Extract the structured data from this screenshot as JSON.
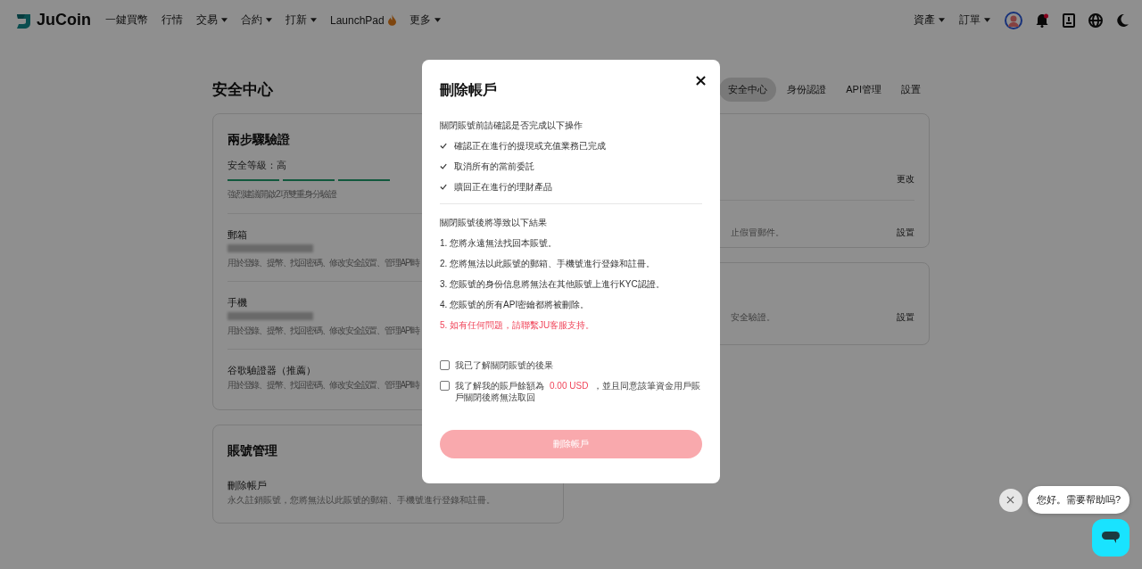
{
  "header": {
    "brand": "JuCoin",
    "nav": [
      {
        "label": "一鍵買幣",
        "dropdown": false,
        "kind": "plain"
      },
      {
        "label": "行情",
        "dropdown": false,
        "kind": "plain"
      },
      {
        "label": "交易",
        "dropdown": true,
        "kind": "plain"
      },
      {
        "label": "合約",
        "dropdown": true,
        "kind": "plain"
      },
      {
        "label": "打新",
        "dropdown": true,
        "kind": "plain"
      },
      {
        "label": "LaunchPad",
        "dropdown": false,
        "kind": "flame"
      },
      {
        "label": "更多",
        "dropdown": true,
        "kind": "plain"
      }
    ],
    "right_menus": [
      {
        "label": "資產",
        "dropdown": true
      },
      {
        "label": "訂單",
        "dropdown": true
      }
    ],
    "notification_dot": true
  },
  "page": {
    "title": "安全中心",
    "tabs": [
      {
        "label": "安全中心",
        "selected": true
      },
      {
        "label": "身份認證",
        "selected": false
      },
      {
        "label": "API管理",
        "selected": false
      },
      {
        "label": "設置",
        "selected": false
      }
    ],
    "two_step": {
      "title": "兩步驟驗證",
      "level_label": "安全等級：高",
      "segments": [
        {
          "filled": true
        },
        {
          "filled": true
        },
        {
          "filled": true
        }
      ],
      "hint": "強烈建議開啟2項雙重身分驗證",
      "rows": [
        {
          "name": "郵箱",
          "value_hidden": true,
          "description": "用於登錄、提幣、找回密碼、修改安全設置、管理API時"
        },
        {
          "name": "手機",
          "value_hidden": true,
          "description": "用於登錄、提幣、找回密碼、修改安全設置、管理API時"
        },
        {
          "name": "谷歌驗證器（推薦）",
          "value_hidden": false,
          "description": "用於登錄、提幣、找回密碼、修改安全設置、管理API時"
        }
      ]
    },
    "account": {
      "title": "賬號管理",
      "rows": [
        {
          "name": "刪除帳戶",
          "description": "永久註銷賬號，您將無法以此賬號的郵箱、手機號進行登錄和註冊。"
        }
      ]
    },
    "right_cards": [
      {
        "rows": [
          {
            "action": "更改"
          },
          {
            "description": "止假冒郵件。",
            "action": "設置"
          }
        ]
      },
      {
        "rows": [
          {
            "description": "安全驗證。",
            "action": "設置"
          }
        ]
      }
    ]
  },
  "modal": {
    "title": "刪除帳戶",
    "intro": "關閉賬號前請確認是否完成以下操作",
    "checks": [
      "確認正在進行的提現或充值業務已完成",
      "取消所有的當前委託",
      "贖回正在進行的理財產品"
    ],
    "consequence_heading": "關閉賬號後將導致以下結果",
    "consequences": [
      {
        "text": "1. 您將永遠無法找回本賬號。",
        "kind": "normal"
      },
      {
        "text": "2. 您將無法以此賬號的郵箱、手機號進行登錄和註冊。",
        "kind": "normal"
      },
      {
        "text": "3. 您賬號的身份信息將無法在其他賬號上進行KYC認證。",
        "kind": "normal"
      },
      {
        "text": "4. 您賬號的所有API密鑰都將被刪除。",
        "kind": "normal"
      },
      {
        "text": "5. 如有任何問題，請聯繫JU客服支持。",
        "kind": "warning"
      }
    ],
    "agreements": [
      {
        "parts": [
          {
            "text": "我已了解關閉賬號的後果",
            "kind": "normal"
          }
        ],
        "checked": false
      },
      {
        "parts": [
          {
            "text": "我了解我的賬戶餘額為",
            "kind": "normal"
          },
          {
            "text": "0.00 USD",
            "kind": "highlight"
          },
          {
            "text": "，並且同意該筆資金用戶賬戶關閉後將無法取回",
            "kind": "normal"
          }
        ],
        "checked": false
      }
    ],
    "button": {
      "label": "刪除帳戶",
      "disabled": true
    }
  },
  "chat": {
    "greeting": "您好。需要帮助吗?"
  }
}
